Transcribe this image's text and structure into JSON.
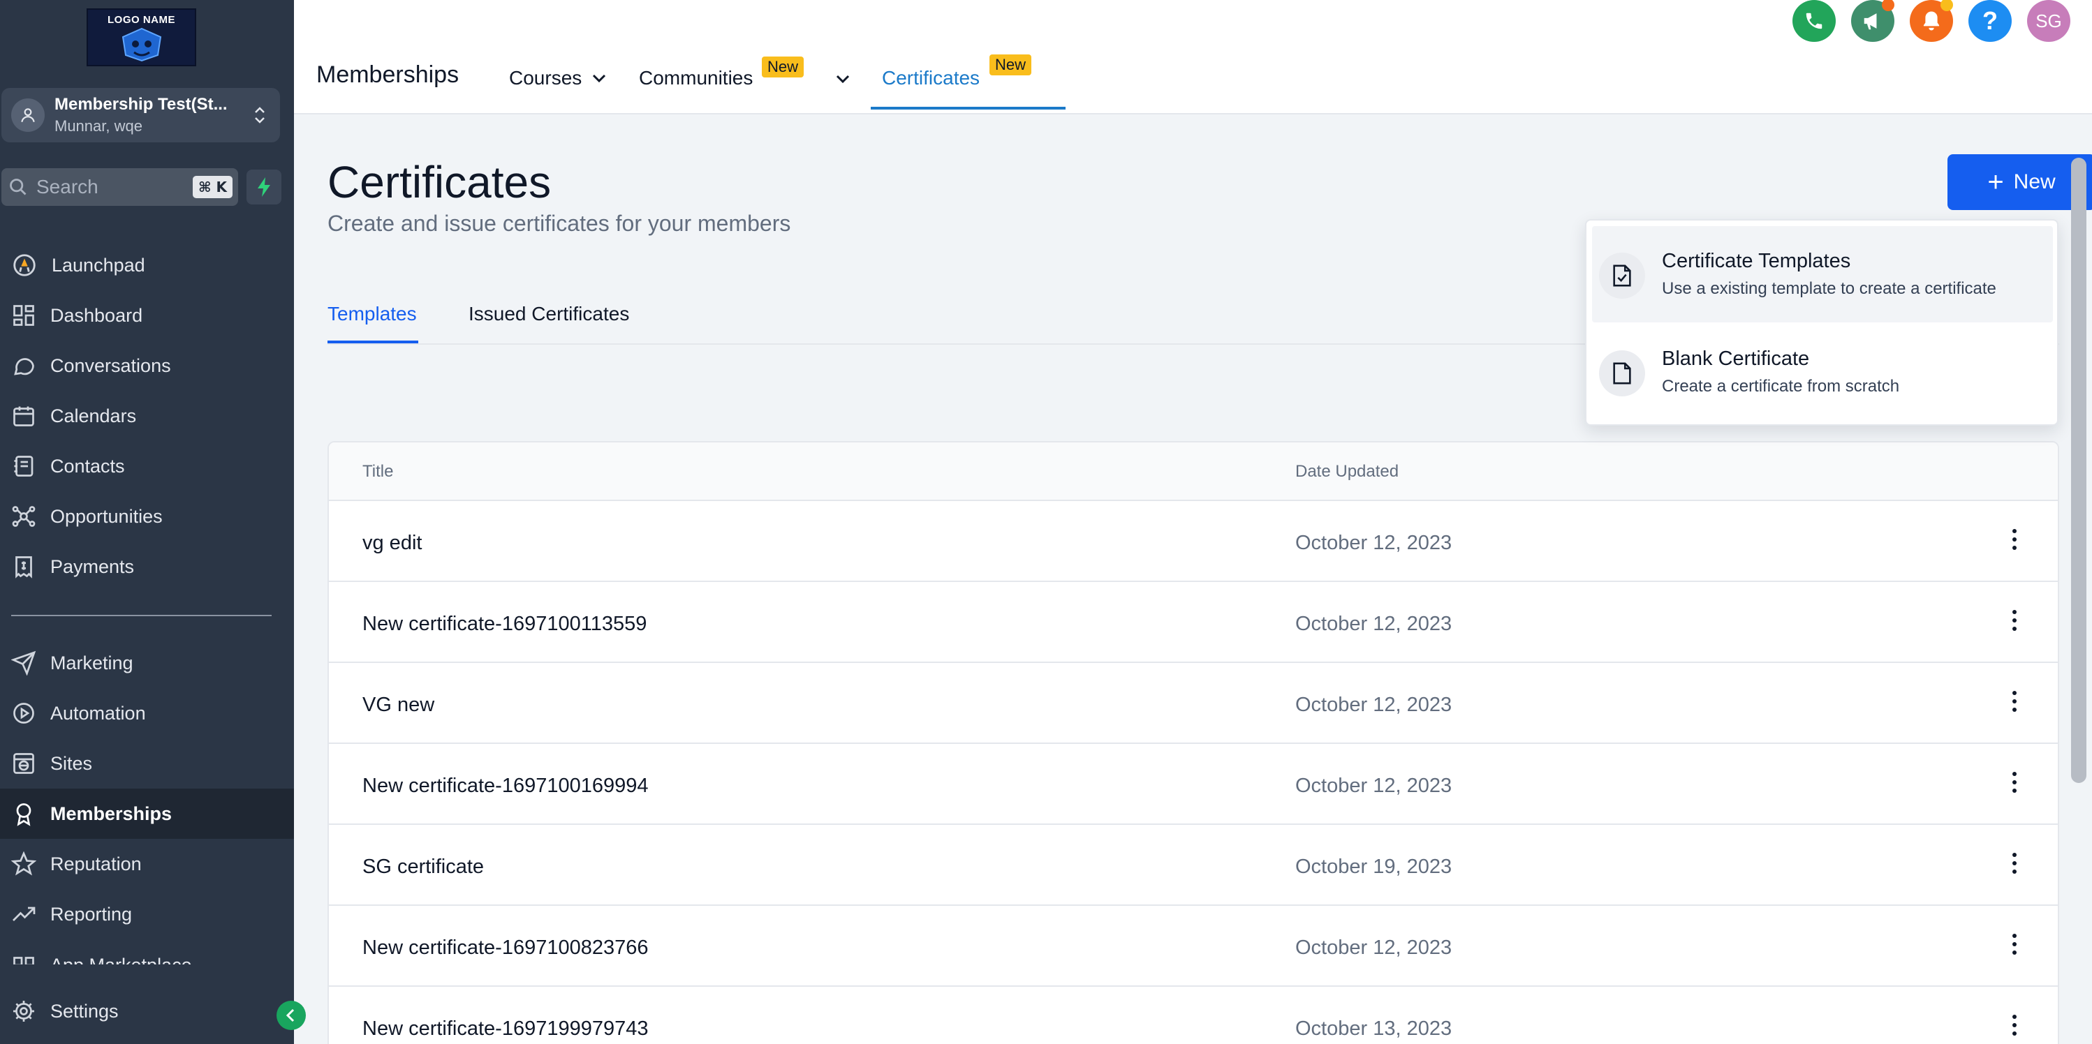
{
  "sidebar": {
    "logo_text": "LOGO NAME",
    "account": {
      "name": "Membership Test(St...",
      "location": "Munnar, wqe"
    },
    "search": {
      "placeholder": "Search",
      "shortcut": "⌘ K"
    },
    "items": [
      {
        "label": "Launchpad",
        "icon": "rocket-icon"
      },
      {
        "label": "Dashboard",
        "icon": "dashboard-icon"
      },
      {
        "label": "Conversations",
        "icon": "chat-icon"
      },
      {
        "label": "Calendars",
        "icon": "calendar-icon"
      },
      {
        "label": "Contacts",
        "icon": "contacts-icon"
      },
      {
        "label": "Opportunities",
        "icon": "opportunities-icon"
      },
      {
        "label": "Payments",
        "icon": "payments-icon"
      }
    ],
    "items2": [
      {
        "label": "Marketing",
        "icon": "send-icon"
      },
      {
        "label": "Automation",
        "icon": "automation-icon"
      },
      {
        "label": "Sites",
        "icon": "sites-icon"
      },
      {
        "label": "Memberships",
        "icon": "award-icon",
        "active": true
      },
      {
        "label": "Reputation",
        "icon": "star-icon"
      },
      {
        "label": "Reporting",
        "icon": "trend-icon"
      },
      {
        "label": "App Marketplace",
        "icon": "marketplace-icon"
      }
    ],
    "settings_label": "Settings"
  },
  "topbar": {
    "title": "Memberships",
    "tabs": [
      {
        "label": "Courses"
      },
      {
        "label": "Communities",
        "badge": "New"
      },
      {
        "label": "Certificates",
        "badge": "New",
        "active": true
      }
    ],
    "user_initials": "SG"
  },
  "page": {
    "title": "Certificates",
    "subtitle": "Create and issue certificates for your members",
    "new_button": "New",
    "tabs": [
      {
        "label": "Templates",
        "active": true
      },
      {
        "label": "Issued Certificates"
      }
    ]
  },
  "dropdown": {
    "items": [
      {
        "title": "Certificate Templates",
        "description": "Use a existing template to create a certificate"
      },
      {
        "title": "Blank Certificate",
        "description": "Create a certificate from scratch"
      }
    ]
  },
  "table": {
    "columns": [
      "Title",
      "Date Updated"
    ],
    "rows": [
      {
        "title": "vg edit",
        "date": "October 12, 2023"
      },
      {
        "title": "New certificate-1697100113559",
        "date": "October 12, 2023"
      },
      {
        "title": "VG new",
        "date": "October 12, 2023"
      },
      {
        "title": "New certificate-1697100169994",
        "date": "October 12, 2023"
      },
      {
        "title": "SG certificate",
        "date": "October 19, 2023"
      },
      {
        "title": "New certificate-1697100823766",
        "date": "October 12, 2023"
      },
      {
        "title": "New certificate-1697199979743",
        "date": "October 13, 2023"
      }
    ]
  },
  "colors": {
    "sidebar_bg": "#2b3646",
    "primary": "#155eef",
    "active_tab": "#1b7ac9",
    "badge": "#f9bd1c",
    "phone": "#22a55a",
    "megaphone": "#3f8f6c",
    "bell": "#f46b1b",
    "help": "#1d8df2",
    "avatar": "#c77dba"
  }
}
